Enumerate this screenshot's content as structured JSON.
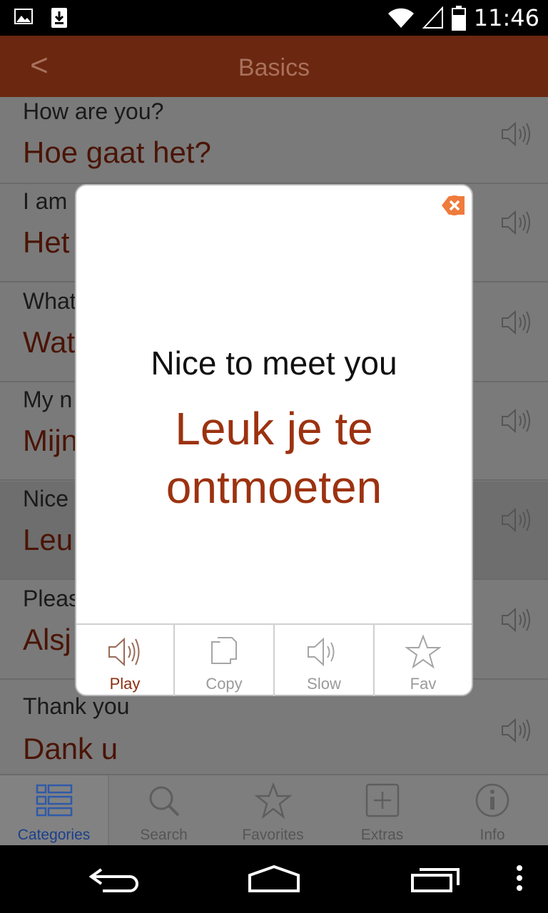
{
  "status_bar": {
    "time": "11:46"
  },
  "header": {
    "back_label": "<",
    "title": "Basics"
  },
  "phrases": [
    {
      "en": "How are you?",
      "nl": "Hoe gaat het?"
    },
    {
      "en": "I am",
      "nl": "Het"
    },
    {
      "en": "What",
      "nl": "Wat"
    },
    {
      "en": "My n",
      "nl": "Mijn"
    },
    {
      "en": "Nice",
      "nl": "Leu"
    },
    {
      "en": "Pleas",
      "nl": "Alsj"
    },
    {
      "en": "Thank you",
      "nl": "Dank u"
    }
  ],
  "dialog": {
    "english": "Nice to meet you",
    "dutch": "Leuk je te ontmoeten",
    "actions": [
      {
        "label": "Play",
        "icon": "speaker-icon"
      },
      {
        "label": "Copy",
        "icon": "copy-icon"
      },
      {
        "label": "Slow",
        "icon": "speaker-slow-icon"
      },
      {
        "label": "Fav",
        "icon": "star-icon"
      }
    ]
  },
  "tabs": [
    {
      "label": "Categories",
      "icon": "categories-icon",
      "active": true
    },
    {
      "label": "Search",
      "icon": "search-icon"
    },
    {
      "label": "Favorites",
      "icon": "star-icon"
    },
    {
      "label": "Extras",
      "icon": "plus-icon"
    },
    {
      "label": "Info",
      "icon": "info-icon"
    }
  ],
  "colors": {
    "header_bg": "#6b2710",
    "accent": "#9c3210",
    "tab_active": "#1a3f8a"
  }
}
